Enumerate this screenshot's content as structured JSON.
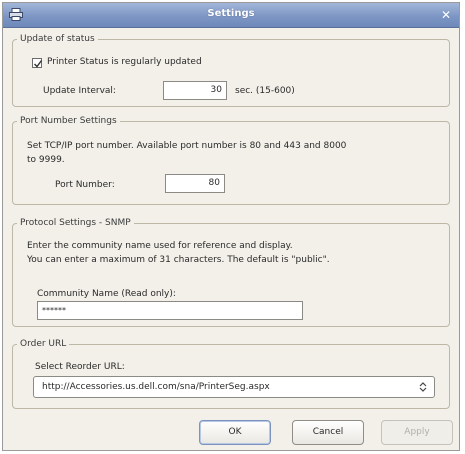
{
  "window": {
    "title": "Settings",
    "icon": "printer-app-icon",
    "close_icon": "close-icon"
  },
  "status_group": {
    "legend": "Update of status",
    "checkbox_label": "Printer Status is regularly updated",
    "checkbox_checked": true,
    "interval_label": "Update Interval:",
    "interval_value": "30",
    "interval_unit": "sec. (15-600)"
  },
  "port_group": {
    "legend": "Port Number Settings",
    "description_line1": "Set TCP/IP port number. Available port number is 80 and 443 and 8000",
    "description_line2": "to 9999.",
    "port_label": "Port Number:",
    "port_value": "80"
  },
  "snmp_group": {
    "legend": "Protocol Settings - SNMP",
    "description_line1": "Enter the community name used for reference and display.",
    "description_line2": "You can enter a maximum of 31 characters. The default is \"public\".",
    "community_label": "Community Name (Read only):",
    "community_value": "******"
  },
  "order_group": {
    "legend": "Order URL",
    "select_label": "Select Reorder URL:",
    "selected_url": "http://Accessories.us.dell.com/sna/PrinterSeg.aspx"
  },
  "buttons": {
    "ok": "OK",
    "cancel": "Cancel",
    "apply": "Apply"
  },
  "colors": {
    "titlebar": "#7d96c4",
    "dialog_bg": "#f2f0e9"
  }
}
